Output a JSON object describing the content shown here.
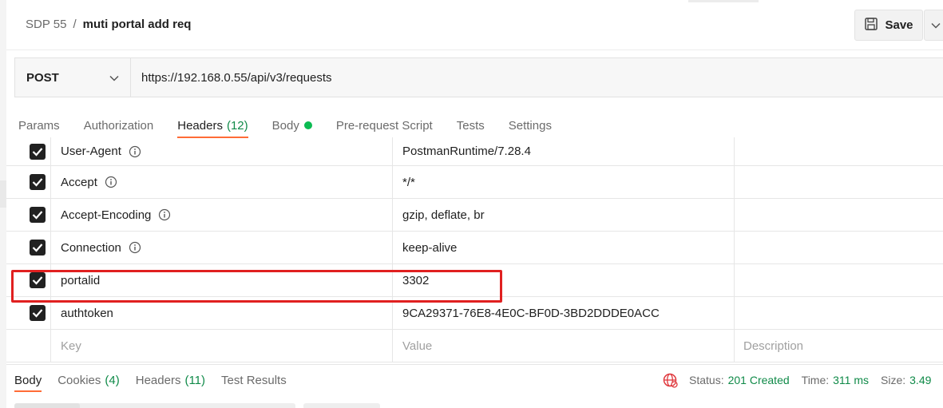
{
  "breadcrumb": {
    "parent": "SDP 55",
    "separator": "/",
    "current": "muti portal add req"
  },
  "toolbar": {
    "save_label": "Save",
    "save_icon": "save-icon",
    "dropdown_icon": "chevron-down-icon"
  },
  "request": {
    "method": "POST",
    "url": "https://192.168.0.55/api/v3/requests"
  },
  "request_tabs": [
    {
      "label": "Params"
    },
    {
      "label": "Authorization"
    },
    {
      "label": "Headers",
      "count": "(12)",
      "active": true
    },
    {
      "label": "Body",
      "dot": true
    },
    {
      "label": "Pre-request Script"
    },
    {
      "label": "Tests"
    },
    {
      "label": "Settings"
    }
  ],
  "headers": [
    {
      "key": "User-Agent",
      "value": "PostmanRuntime/7.28.4",
      "checked": true,
      "info": true
    },
    {
      "key": "Accept",
      "value": "*/*",
      "checked": true,
      "info": true
    },
    {
      "key": "Accept-Encoding",
      "value": "gzip, deflate, br",
      "checked": true,
      "info": true
    },
    {
      "key": "Connection",
      "value": "keep-alive",
      "checked": true,
      "info": true
    },
    {
      "key": "portalid",
      "value": "3302",
      "checked": true,
      "info": false
    },
    {
      "key": "authtoken",
      "value": "9CA29371-76E8-4E0C-BF0D-3BD2DDDE0ACC",
      "checked": true,
      "info": false
    }
  ],
  "new_row": {
    "key_placeholder": "Key",
    "value_placeholder": "Value",
    "description_placeholder": "Description"
  },
  "response_tabs": [
    {
      "label": "Body",
      "active": true
    },
    {
      "label": "Cookies",
      "count": "(4)"
    },
    {
      "label": "Headers",
      "count": "(11)"
    },
    {
      "label": "Test Results"
    }
  ],
  "response_status": {
    "status_label": "Status:",
    "status_value": "201 Created",
    "time_label": "Time:",
    "time_value": "311 ms",
    "size_label": "Size:",
    "size_value": "3.49"
  },
  "colors": {
    "accent": "#ff6c37",
    "green": "#0f8a48",
    "highlight": "#e02020"
  }
}
